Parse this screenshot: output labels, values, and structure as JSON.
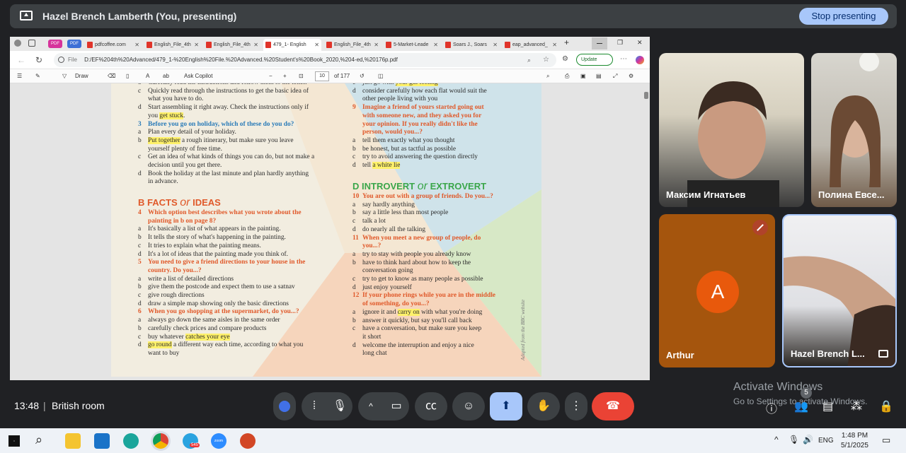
{
  "top_bar": {
    "presenter": "Hazel Brench Lamberth (You, presenting)",
    "stop_button": "Stop presenting"
  },
  "browser": {
    "tabs": [
      {
        "label": "PDF"
      },
      {
        "label": "PDF"
      },
      {
        "label": "pdfcoffee.com"
      },
      {
        "label": "English_File_4th"
      },
      {
        "label": "English_File_4th"
      },
      {
        "label": "479_1- English"
      },
      {
        "label": "English_File_4th"
      },
      {
        "label": "5-Market-Leade"
      },
      {
        "label": "Soars J., Soars"
      },
      {
        "label": "eap_advanced_"
      }
    ],
    "url_prefix": "File",
    "url": "D:/EF%204th%20Advanced/479_1-%20English%20File.%20Advanced.%20Student's%20Book_2020,%204-ed,%20176p.pdf",
    "update_label": "Update",
    "toolbar": {
      "draw": "Draw",
      "ask_copilot": "Ask Copilot",
      "page_number": "10",
      "page_total": "of 177"
    }
  },
  "document": {
    "left_col": [
      {
        "k": "opt",
        "l": "b",
        "t": "Carefully read the instructions and follow them to the letter."
      },
      {
        "k": "opt",
        "l": "c",
        "t": "Quickly read through the instructions to get the basic idea of"
      },
      {
        "k": "cont",
        "t": "what you have to do."
      },
      {
        "k": "opt",
        "l": "d",
        "t": "Start assembling it right away. Check the instructions only if"
      },
      {
        "k": "cont",
        "pre": "you ",
        "hl": "get stuck",
        "post": "."
      },
      {
        "k": "qb",
        "n": "3",
        "t": "Before you go on holiday, which of these do you do?"
      },
      {
        "k": "opt",
        "l": "a",
        "t": "Plan every detail of your holiday."
      },
      {
        "k": "opt",
        "l": "b",
        "hl": "Put together",
        "post": " a rough itinerary, but make sure you leave"
      },
      {
        "k": "cont",
        "t": "yourself plenty of free time."
      },
      {
        "k": "opt",
        "l": "c",
        "t": "Get an idea of what kinds of things you can do, but not make a"
      },
      {
        "k": "cont",
        "t": "decision until you get there."
      },
      {
        "k": "opt",
        "l": "d",
        "t": "Book the holiday at the last minute and plan hardly anything"
      },
      {
        "k": "cont",
        "t": "in advance."
      }
    ],
    "left_col2": [
      {
        "k": "q",
        "n": "4",
        "t": "Which option best describes what you wrote about the"
      },
      {
        "k": "qc",
        "t": "painting in b on page 8?"
      },
      {
        "k": "opt",
        "l": "a",
        "t": "It's basically a list of what appears in the painting."
      },
      {
        "k": "opt",
        "l": "b",
        "t": "It tells the story of what's happening in the painting."
      },
      {
        "k": "opt",
        "l": "c",
        "t": "It tries to explain what the painting means."
      },
      {
        "k": "opt",
        "l": "d",
        "t": "It's a lot of ideas that the painting made you think of."
      },
      {
        "k": "q",
        "n": "5",
        "t": "You need to give a friend directions to your house in the"
      },
      {
        "k": "qc",
        "t": "country. Do you...?"
      },
      {
        "k": "opt",
        "l": "a",
        "t": "write a list of detailed directions"
      },
      {
        "k": "opt",
        "l": "b",
        "t": "give them the postcode and expect them to use a satnav"
      },
      {
        "k": "opt",
        "l": "c",
        "t": "give rough directions"
      },
      {
        "k": "opt",
        "l": "d",
        "t": "draw a simple map showing only the basic directions"
      },
      {
        "k": "q",
        "n": "6",
        "t": "When you go shopping at the supermarket, do you...?"
      },
      {
        "k": "opt",
        "l": "a",
        "t": "always go down the same aisles in the same order"
      },
      {
        "k": "opt",
        "l": "b",
        "t": "carefully check prices and compare products"
      },
      {
        "k": "opt",
        "l": "c",
        "t": "buy whatever ",
        "hl": "catches your eye",
        "post": ""
      },
      {
        "k": "opt",
        "l": "d",
        "hl": "go round",
        "post": " a different way each time, according to what you"
      },
      {
        "k": "cont",
        "t": "want to buy"
      }
    ],
    "right_col": [
      {
        "k": "opt",
        "l": "c",
        "t": "just go with ",
        "hl": "your gut feeling",
        "post": ""
      },
      {
        "k": "opt",
        "l": "d",
        "t": "consider carefully how each flat would suit the"
      },
      {
        "k": "cont",
        "t": "other people living with you"
      },
      {
        "k": "q",
        "n": "9",
        "t": "Imagine a friend of yours started going out"
      },
      {
        "k": "qc",
        "t": "with someone new, and they asked you for"
      },
      {
        "k": "qc",
        "t": "your opinion. If you really didn't like the"
      },
      {
        "k": "qc",
        "t": "person, would you...?"
      },
      {
        "k": "opt",
        "l": "a",
        "t": "tell them exactly what you thought"
      },
      {
        "k": "opt",
        "l": "b",
        "t": "be honest, but as tactful as possible"
      },
      {
        "k": "opt",
        "l": "c",
        "t": "try to avoid answering the question directly"
      },
      {
        "k": "opt",
        "l": "d",
        "t": "tell ",
        "hl": "a white lie",
        "post": ""
      }
    ],
    "right_col2": [
      {
        "k": "q",
        "n": "10",
        "t": "You are out with a group of friends. Do you...?"
      },
      {
        "k": "opt",
        "l": "a",
        "t": "say hardly anything"
      },
      {
        "k": "opt",
        "l": "b",
        "t": "say a little less than most people"
      },
      {
        "k": "opt",
        "l": "c",
        "t": "talk a lot"
      },
      {
        "k": "opt",
        "l": "d",
        "t": "do nearly all the talking"
      },
      {
        "k": "q",
        "n": "11",
        "t": "When you meet a new group of people, do"
      },
      {
        "k": "qc",
        "t": "you...?"
      },
      {
        "k": "opt",
        "l": "a",
        "t": "try to stay with people you already know"
      },
      {
        "k": "opt",
        "l": "b",
        "t": "have to think hard about how to keep the"
      },
      {
        "k": "cont",
        "t": "conversation going"
      },
      {
        "k": "opt",
        "l": "c",
        "t": "try to get to know as many people as possible"
      },
      {
        "k": "opt",
        "l": "d",
        "t": "just enjoy yourself"
      },
      {
        "k": "q",
        "n": "12",
        "t": "If your phone rings while you are in the middle"
      },
      {
        "k": "qc",
        "t": "of something, do you...?"
      },
      {
        "k": "opt",
        "l": "a",
        "t": "ignore it and ",
        "hl": "carry on",
        "post": " with what you're doing"
      },
      {
        "k": "opt",
        "l": "b",
        "t": "answer it quickly, but say you'll call back"
      },
      {
        "k": "opt",
        "l": "c",
        "t": "have a conversation, but make sure you keep"
      },
      {
        "k": "cont",
        "t": "it short"
      },
      {
        "k": "opt",
        "l": "d",
        "t": "welcome the interruption and enjoy a nice"
      },
      {
        "k": "cont",
        "t": "long chat"
      }
    ],
    "section_b": {
      "a": "B FACTS ",
      "or": "or",
      "b": " IDEAS"
    },
    "section_d": {
      "a": "D INTROVERT ",
      "or": "or",
      "b": " EXTROVERT"
    },
    "side_note": "Adapted from the BBC website"
  },
  "participants": [
    {
      "name": "Максим Игнатьев"
    },
    {
      "name": "Полина Евсе..."
    },
    {
      "name": "Arthur",
      "initial": "A"
    },
    {
      "name": "Hazel Brench L..."
    }
  ],
  "meeting": {
    "time": "13:48",
    "separator": "|",
    "room": "British room",
    "people_count": "5",
    "watermark_title": "Activate Windows",
    "watermark_sub": "Go to Settings to activate Windows."
  },
  "taskbar": {
    "telegram_badge": "545",
    "zoom_label": "zoom",
    "lang": "ENG",
    "time": "1:48 PM",
    "date": "5/1/2025"
  }
}
